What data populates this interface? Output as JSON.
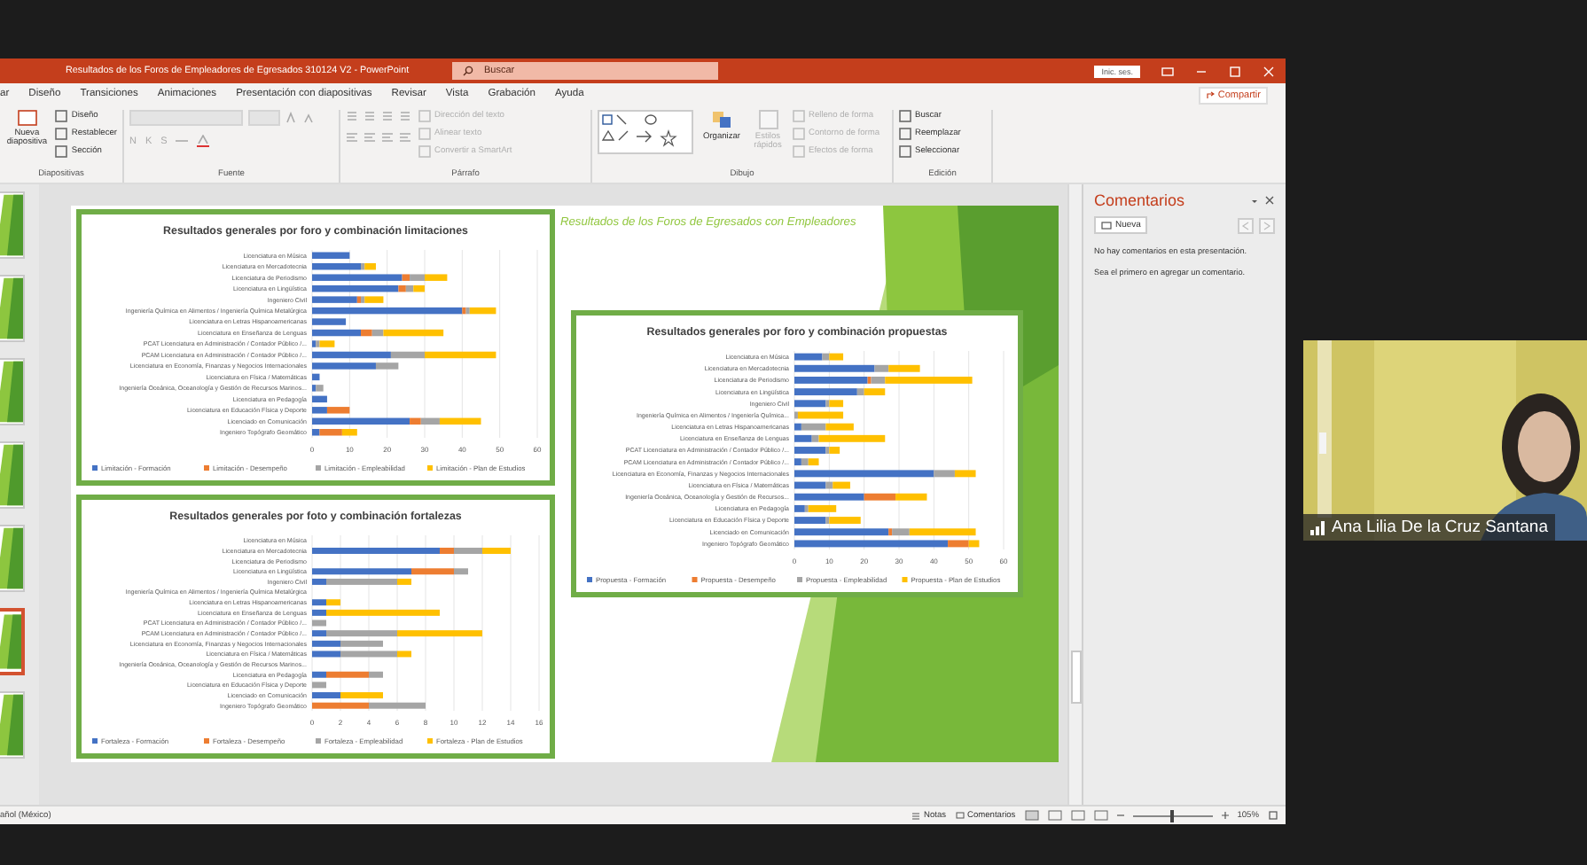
{
  "window": {
    "title": "Resultados de los Foros de Empleadores de Egresados 310124 V2  -  PowerPoint",
    "search": {
      "placeholder": "Buscar"
    },
    "account": "Inic. ses."
  },
  "ribbon": {
    "tabs": [
      {
        "label": "ar",
        "selected": false
      },
      {
        "label": "Diseño",
        "selected": false
      },
      {
        "label": "Transiciones",
        "selected": false
      },
      {
        "label": "Animaciones",
        "selected": false
      },
      {
        "label": "Presentación con diapositivas",
        "selected": false
      },
      {
        "label": "Revisar",
        "selected": false
      },
      {
        "label": "Vista",
        "selected": false
      },
      {
        "label": "Grabación",
        "selected": false
      },
      {
        "label": "Ayuda",
        "selected": false
      }
    ],
    "share": "Compartir",
    "groups": [
      {
        "kind": "slides",
        "label": "Diapositivas",
        "items": [
          {
            "label": "Nueva diapositiva",
            "disabled": false
          },
          {
            "label": "Diseño",
            "disabled": false
          },
          {
            "label": "Restablecer",
            "disabled": false
          },
          {
            "label": "Sección",
            "disabled": false
          }
        ]
      },
      {
        "kind": "font",
        "label": "Fuente",
        "items": [
          {
            "label": "N",
            "disabled": true
          },
          {
            "label": "K",
            "disabled": true
          },
          {
            "label": "S",
            "disabled": true
          }
        ]
      },
      {
        "kind": "paragraph",
        "label": "Párrafo",
        "items": [
          {
            "label": "Dirección del texto",
            "disabled": true
          },
          {
            "label": "Alinear texto",
            "disabled": true
          },
          {
            "label": "Convertir a SmartArt",
            "disabled": true
          }
        ]
      },
      {
        "kind": "drawing",
        "label": "Dibujo",
        "items": [
          {
            "label": "Organizar",
            "disabled": false
          },
          {
            "label": "Estilos rápidos",
            "disabled": true
          },
          {
            "label": "Relleno de forma",
            "disabled": true
          },
          {
            "label": "Contorno de forma",
            "disabled": true
          },
          {
            "label": "Efectos de forma",
            "disabled": true
          }
        ]
      },
      {
        "kind": "editing",
        "label": "Edición",
        "items": [
          {
            "label": "Buscar",
            "disabled": false
          },
          {
            "label": "Reemplazar",
            "disabled": false
          },
          {
            "label": "Seleccionar",
            "disabled": false
          }
        ]
      }
    ]
  },
  "thumbnails": [
    {
      "selected": false
    },
    {
      "selected": false
    },
    {
      "selected": false
    },
    {
      "selected": false
    },
    {
      "selected": false
    },
    {
      "selected": true
    },
    {
      "selected": false
    }
  ],
  "slide": {
    "title": "Resultados de los Foros de Egresados con Empleadores",
    "charts": [
      {
        "chart_data": {
          "type": "bar",
          "orientation": "horizontal",
          "stacked": true,
          "title": "Resultados generales por foro y combinación limitaciones",
          "categories": [
            "Licenciatura en Música",
            "Licenciatura en Mercadotecnia",
            "Licenciatura de Periodismo",
            "Licenciatura en Lingüística",
            "Ingeniero Civil",
            "Ingeniería Química en Alimentos / Ingeniería Química Metalúrgica",
            "Licenciatura en Letras Hispanoamericanas",
            "Licenciatura en Enseñanza de Lenguas",
            "PCAT Licenciatura en Administración / Contador Público /...",
            "PCAM Licenciatura en Administración / Contador Público /...",
            "Licenciatura en Economía, Finanzas y Negocios Internacionales",
            "Licenciatura en Física / Matemáticas",
            "Ingeniería Oceánica, Oceanología y Gestión de Recursos Marinos...",
            "Licenciatura en Pedagogía",
            "Licenciatura en Educación Física y Deporte",
            "Licenciado en Comunicación",
            "Ingeniero Topógrafo Geomático"
          ],
          "series": [
            {
              "name": "Limitación - Formación",
              "color": "#4472c4",
              "values": [
                10,
                13,
                24,
                23,
                12,
                40,
                9,
                13,
                1,
                21,
                17,
                2,
                1,
                4,
                4,
                26,
                2
              ]
            },
            {
              "name": "Limitación - Desempeño",
              "color": "#ed7d31",
              "values": [
                0,
                0,
                2,
                2,
                1,
                1,
                0,
                3,
                0,
                0,
                0,
                0,
                0,
                0,
                6,
                3,
                6
              ]
            },
            {
              "name": "Limitación - Empleabilidad",
              "color": "#a5a5a5",
              "values": [
                0,
                1,
                4,
                2,
                1,
                1,
                0,
                3,
                1,
                9,
                6,
                0,
                2,
                0,
                0,
                5,
                0
              ]
            },
            {
              "name": "Limitación - Plan de Estudios",
              "color": "#ffc000",
              "values": [
                0,
                3,
                6,
                3,
                5,
                7,
                0,
                16,
                4,
                19,
                0,
                0,
                0,
                0,
                0,
                11,
                4
              ]
            }
          ],
          "xlim": [
            0,
            60
          ],
          "xticks": [
            0,
            10,
            20,
            30,
            40,
            50,
            60
          ],
          "grid": true,
          "legend": true
        }
      },
      {
        "chart_data": {
          "type": "bar",
          "orientation": "horizontal",
          "stacked": true,
          "title": "Resultados generales por foto y combinación fortalezas",
          "categories": [
            "Licenciatura en Música",
            "Licenciatura en Mercadotecnia",
            "Licenciatura de Periodismo",
            "Licenciatura en Lingüística",
            "Ingeniero Civil",
            "Ingeniería Química en Alimentos / Ingeniería Química Metalúrgica",
            "Licenciatura en Letras Hispanoamericanas",
            "Licenciatura en Enseñanza de Lenguas",
            "PCAT Licenciatura en Administración / Contador Público /...",
            "PCAM Licenciatura en Administración / Contador Público /...",
            "Licenciatura en Economía, Finanzas y Negocios Internacionales",
            "Licenciatura en Física / Matemáticas",
            "Ingeniería Oceánica, Oceanología y Gestión de Recursos Marinos...",
            "Licenciatura en Pedagogía",
            "Licenciatura en Educación Física y Deporte",
            "Licenciado en Comunicación",
            "Ingeniero Topógrafo Geomático"
          ],
          "series": [
            {
              "name": "Fortaleza - Formación",
              "color": "#4472c4",
              "values": [
                0,
                9,
                0,
                7,
                1,
                0,
                1,
                1,
                0,
                1,
                2,
                2,
                0,
                1,
                0,
                2,
                0
              ]
            },
            {
              "name": "Fortaleza - Desempeño",
              "color": "#ed7d31",
              "values": [
                0,
                1,
                0,
                3,
                0,
                0,
                0,
                0,
                0,
                0,
                0,
                0,
                0,
                3,
                0,
                0,
                4
              ]
            },
            {
              "name": "Fortaleza - Empleabilidad",
              "color": "#a5a5a5",
              "values": [
                0,
                2,
                0,
                1,
                5,
                0,
                0,
                0,
                1,
                5,
                3,
                4,
                0,
                1,
                1,
                0,
                4
              ]
            },
            {
              "name": "Fortaleza - Plan de Estudios",
              "color": "#ffc000",
              "values": [
                0,
                2,
                0,
                0,
                1,
                0,
                1,
                8,
                0,
                6,
                0,
                1,
                0,
                0,
                0,
                3,
                0
              ]
            }
          ],
          "xlim": [
            0,
            16
          ],
          "xticks": [
            0,
            2,
            4,
            6,
            8,
            10,
            12,
            14,
            16
          ],
          "grid": true,
          "legend": true
        }
      },
      {
        "chart_data": {
          "type": "bar",
          "orientation": "horizontal",
          "stacked": true,
          "title": "Resultados generales por foro y combinación propuestas",
          "categories": [
            "Licenciatura en Música",
            "Licenciatura en Mercadotecnia",
            "Licenciatura de Periodismo",
            "Licenciatura en Lingüística",
            "Ingeniero Civil",
            "Ingeniería Química en Alimentos / Ingeniería Química...",
            "Licenciatura en Letras Hispanoamericanas",
            "Licenciatura en Enseñanza de Lenguas",
            "PCAT Licenciatura en Administración / Contador Público /...",
            "PCAM Licenciatura en Administración / Contador Público /...",
            "Licenciatura en Economía, Finanzas y Negocios Internacionales",
            "Licenciatura en Física / Matemáticas",
            "Ingeniería Oceánica, Oceanología y Gestión de Recursos...",
            "Licenciatura en Pedagogía",
            "Licenciatura en Educación Física y Deporte",
            "Licenciado en Comunicación",
            "Ingeniero Topógrafo Geomático"
          ],
          "series": [
            {
              "name": "Propuesta - Formación",
              "color": "#4472c4",
              "values": [
                8,
                23,
                21,
                18,
                9,
                0,
                2,
                5,
                9,
                2,
                40,
                9,
                20,
                3,
                9,
                27,
                44
              ]
            },
            {
              "name": "Propuesta - Desempeño",
              "color": "#ed7d31",
              "values": [
                0,
                0,
                1,
                0,
                0,
                0,
                0,
                0,
                0,
                0,
                0,
                0,
                9,
                0,
                0,
                1,
                6
              ]
            },
            {
              "name": "Propuesta - Empleabilidad",
              "color": "#a5a5a5",
              "values": [
                2,
                4,
                4,
                2,
                1,
                1,
                7,
                2,
                1,
                2,
                6,
                2,
                0,
                1,
                1,
                5,
                0
              ]
            },
            {
              "name": "Propuesta - Plan de Estudios",
              "color": "#ffc000",
              "values": [
                4,
                9,
                25,
                6,
                4,
                13,
                8,
                19,
                3,
                3,
                6,
                5,
                9,
                8,
                9,
                19,
                3
              ]
            }
          ],
          "xlim": [
            0,
            60
          ],
          "xticks": [
            0,
            10,
            20,
            30,
            40,
            50,
            60
          ],
          "grid": true,
          "legend": true
        }
      }
    ]
  },
  "comments": {
    "title": "Comentarios",
    "new_button": "Nueva",
    "messages": [
      "No hay comentarios en esta presentación.",
      "Sea el primero en agregar un comentario."
    ]
  },
  "status_bar": {
    "language": "añol (México)",
    "notes": "Notas",
    "comments": "Comentarios",
    "zoom": {
      "level": 0.5,
      "reading": "105%"
    }
  },
  "participant": {
    "name": "Ana Lilia De la Cruz Santana"
  }
}
